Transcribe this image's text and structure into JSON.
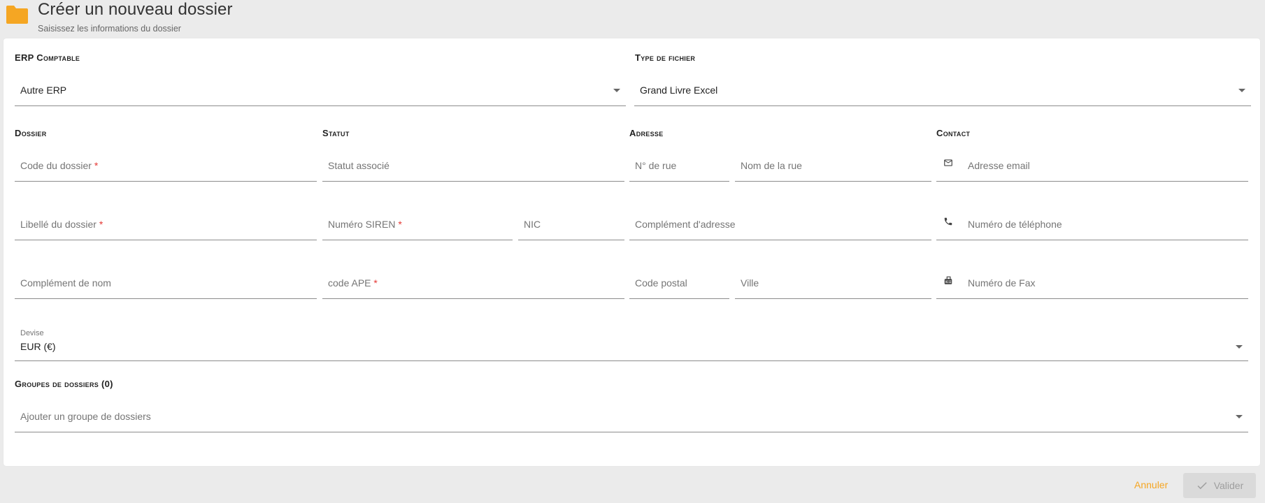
{
  "header": {
    "title": "Créer un nouveau dossier",
    "subtitle": "Saisissez les informations du dossier"
  },
  "sections": {
    "erp": "ERP Comptable",
    "file_type": "Type de fichier",
    "dossier": "Dossier",
    "statut": "Statut",
    "adresse": "Adresse",
    "contact": "Contact",
    "groups": "Groupes de dossiers (0)"
  },
  "fields": {
    "erp_value": "Autre ERP",
    "file_type_value": "Grand Livre Excel",
    "code_dossier": "Code du dossier",
    "libelle_dossier": "Libellé du dossier",
    "complement_nom": "Complément de nom",
    "statut_associe": "Statut associé",
    "numero_siren": "Numéro SIREN",
    "nic": "NIC",
    "code_ape": "code APE",
    "numero_rue": "N° de rue",
    "nom_rue": "Nom de la rue",
    "complement_adresse": "Complément d'adresse",
    "code_postal": "Code postal",
    "ville": "Ville",
    "email": "Adresse email",
    "telephone": "Numéro de téléphone",
    "fax": "Numéro de Fax",
    "devise_label": "Devise",
    "devise_value": "EUR (€)",
    "group_placeholder": "Ajouter un groupe de dossiers",
    "required_mark": "*"
  },
  "actions": {
    "cancel": "Annuler",
    "validate": "Valider"
  },
  "colors": {
    "accent": "#f5a623",
    "required": "#e53935"
  },
  "icons": {
    "folder": "folder-icon",
    "email": "email-icon",
    "phone": "phone-icon",
    "fax": "fax-icon",
    "dropdown": "chevron-down-icon",
    "check": "check-icon"
  }
}
